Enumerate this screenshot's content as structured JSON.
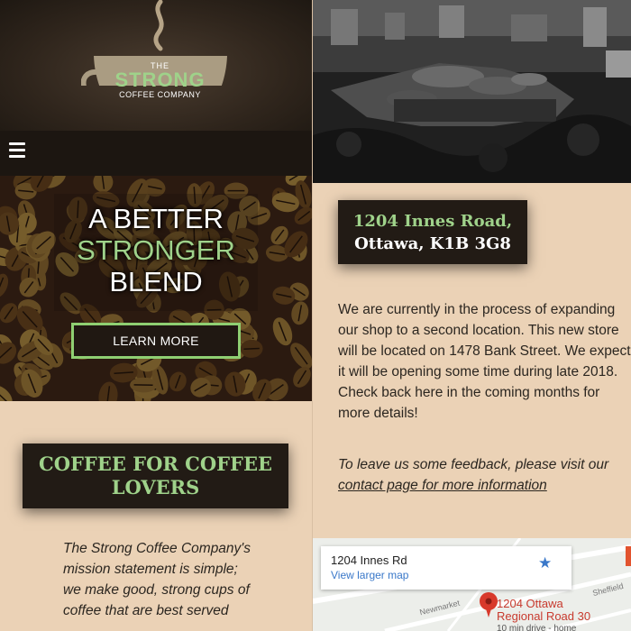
{
  "logo": {
    "the": "THE",
    "strong": "STRONG",
    "company": "COFFEE COMPANY"
  },
  "hero": {
    "line1": "A BETTER",
    "line2": "STRONGER",
    "line3": "BLEND",
    "button": "LEARN MORE"
  },
  "mission": {
    "title": "COFFEE FOR COFFEE LOVERS",
    "text": "The Strong Coffee Company's mission statement is simple; we make good, strong cups of coffee that are best served"
  },
  "address": {
    "line1": "1204 Innes Road,",
    "line2": "Ottawa, K1B 3G8"
  },
  "expansion": {
    "text": "We are currently in the process of expanding our shop to a second location. This new store will be located on 1478 Bank Street. We expect it will be opening some time during late 2018. Check back here in the coming months for more details!"
  },
  "feedback": {
    "text": "To leave us some feedback, please visit our ",
    "link": "contact page for more information"
  },
  "map": {
    "card_title": "1204 Innes Rd",
    "card_link": "View larger map",
    "pin_label_1": "1204 Ottawa",
    "pin_label_2": "Regional Road 30",
    "pin_sub": "10 min drive - home",
    "road_1": "Newmarket",
    "road_2": "Sheffield"
  },
  "colors": {
    "accent_green": "#9fd28a",
    "dark_box": "#221b15",
    "page_bg": "#ebd2b6"
  }
}
